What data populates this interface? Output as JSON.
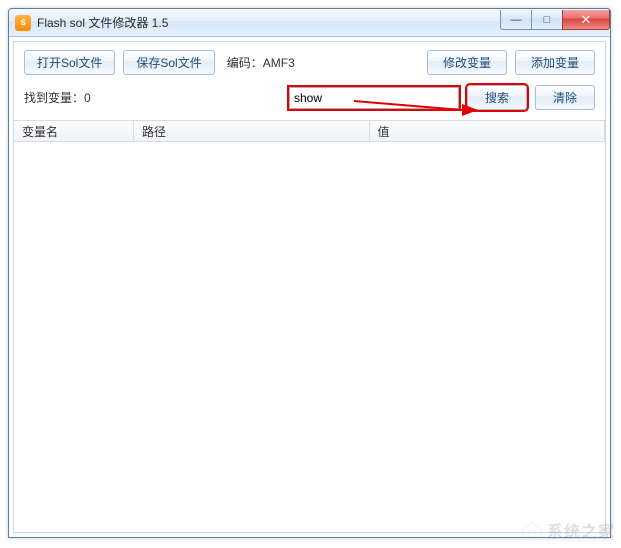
{
  "window": {
    "title": "Flash sol 文件修改器 1.5",
    "minimize_glyph": "—",
    "maximize_glyph": "□",
    "close_glyph": "✕"
  },
  "toolbar": {
    "open_label": "打开Sol文件",
    "save_label": "保存Sol文件",
    "encoding_label": "编码：",
    "encoding_value": "AMF3",
    "modify_label": "修改变量",
    "add_label": "添加变量"
  },
  "search": {
    "found_prefix": "找到变量：",
    "found_count": "0",
    "input_value": "show",
    "search_label": "搜索",
    "clear_label": "清除"
  },
  "table": {
    "col_name": "变量名",
    "col_path": "路径",
    "col_value": "值"
  },
  "watermark": "系统之家"
}
